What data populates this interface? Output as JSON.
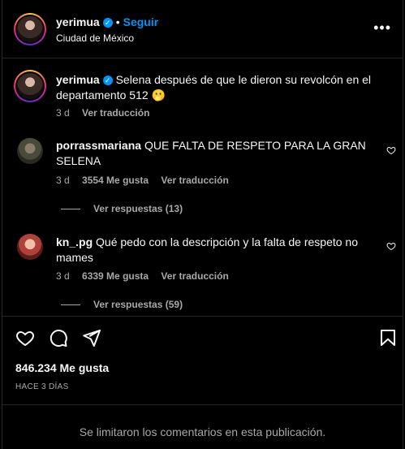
{
  "header": {
    "username": "yerimua",
    "separator": "•",
    "follow_label": "Seguir",
    "location": "Ciudad de México",
    "more_label": "•••"
  },
  "caption": {
    "username": "yerimua",
    "text": "Selena después de que le dieron su revolcón en el departamento 512",
    "emoji": "🫢",
    "time": "3 d",
    "translate_label": "Ver traducción"
  },
  "comments": [
    {
      "username": "porrassmariana",
      "text": "QUE FALTA DE RESPETO PARA LA GRAN SELENA",
      "time": "3 d",
      "likes": "3554 Me gusta",
      "translate_label": "Ver traducción",
      "replies": "Ver respuestas (13)"
    },
    {
      "username": "kn_.pg",
      "text": "Qué pedo con la descripción y la falta de respeto no mames",
      "time": "3 d",
      "likes": "6339 Me gusta",
      "translate_label": "Ver traducción",
      "replies": "Ver respuestas (59)"
    }
  ],
  "actions": {
    "like_icon": "heart-icon",
    "comment_icon": "comment-icon",
    "share_icon": "send-icon",
    "save_icon": "bookmark-icon"
  },
  "likes_count": "846.234 Me gusta",
  "posted_ago": "HACE 3 DÍAS",
  "comments_limited": "Se limitaron los comentarios en esta publicación.",
  "colors": {
    "background": "#000000",
    "text": "#f5f5f5",
    "secondary_text": "#a8a8a8",
    "accent": "#0095f6",
    "border": "#262626"
  }
}
